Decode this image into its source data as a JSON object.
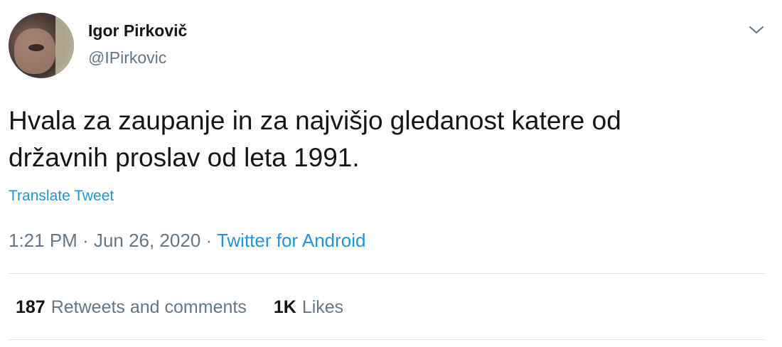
{
  "tweet": {
    "author_name": "Igor Pirkovič",
    "author_handle": "@IPirkovic",
    "text_line1": "Hvala za zaupanje in za najvišjo gledanost katere od",
    "text_line2": "državnih proslav od leta 1991.",
    "translate_label": "Translate Tweet",
    "time": "1:21 PM",
    "separator1": " · ",
    "date": "Jun 26, 2020",
    "separator2": " · ",
    "source": "Twitter for Android"
  },
  "stats": {
    "retweets_count": "187",
    "retweets_label": "Retweets and comments",
    "likes_count": "1K",
    "likes_label": "Likes"
  },
  "icons": {
    "menu": "chevron-down-icon",
    "avatar": "avatar"
  },
  "colors": {
    "text": "#14171a",
    "secondary": "#657786",
    "link": "#1b95e0",
    "divider": "#e1e8ed"
  }
}
